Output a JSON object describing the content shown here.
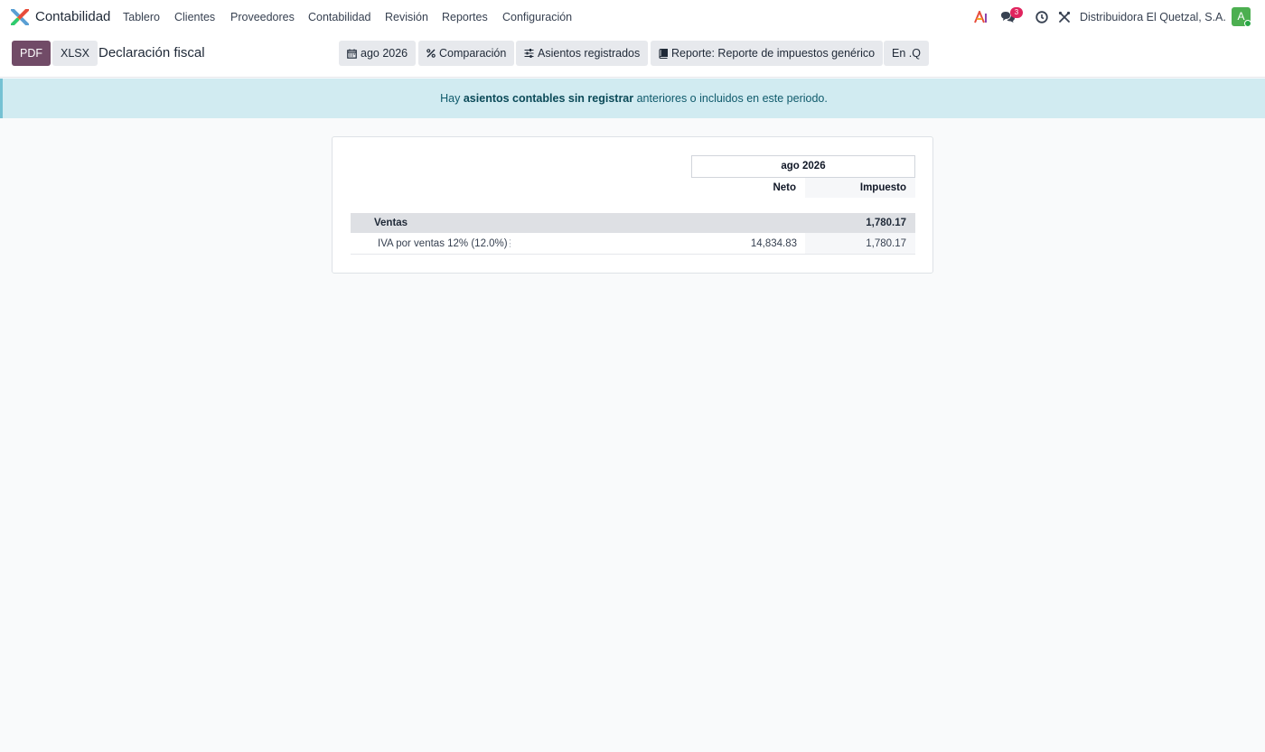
{
  "navbar": {
    "app_name": "Contabilidad",
    "menu": [
      {
        "label": "Tablero"
      },
      {
        "label": "Clientes"
      },
      {
        "label": "Proveedores"
      },
      {
        "label": "Contabilidad"
      },
      {
        "label": "Revisión"
      },
      {
        "label": "Reportes"
      },
      {
        "label": "Configuración"
      }
    ],
    "messages_badge": "3",
    "company": "Distribuidora El Quetzal, S.A.",
    "avatar_letter": "A"
  },
  "control_panel": {
    "pdf_label": "PDF",
    "xlsx_label": "XLSX",
    "title": "Declaración fiscal",
    "filters": {
      "period": "ago 2026",
      "comparison": "Comparación",
      "entries": "Asientos registrados",
      "report": "Reporte: Reporte de impuestos genérico",
      "currency": "En .Q"
    }
  },
  "alert": {
    "prefix": "Hay",
    "link": "asientos contables sin registrar",
    "suffix": "anteriores o incluidos en este periodo."
  },
  "report": {
    "period_header": "ago 2026",
    "columns": {
      "neto": "Neto",
      "impuesto": "Impuesto"
    },
    "section": {
      "label": "Ventas",
      "impuesto": "1,780.17"
    },
    "lines": [
      {
        "label": "IVA por ventas 12% (12.0%)",
        "neto": "14,834.83",
        "impuesto": "1,780.17"
      }
    ]
  },
  "colors": {
    "primary": "#714b67",
    "alert_bg": "#d1ebf1",
    "alert_text": "#0f5a6b",
    "badge": "#e0245e",
    "avatar": "#4caf50"
  }
}
